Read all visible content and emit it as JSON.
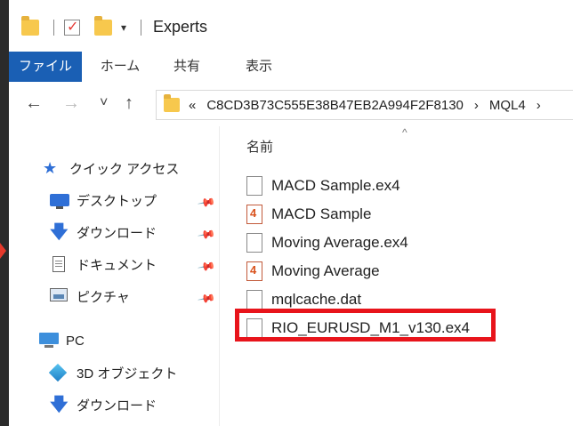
{
  "window": {
    "title": "Experts"
  },
  "ribbon": {
    "tabs": [
      "ファイル",
      "ホーム",
      "共有",
      "表示"
    ]
  },
  "nav": {
    "back": "←",
    "forward": "→",
    "recent": "˅",
    "up": "↑"
  },
  "address": {
    "overflow": "«",
    "parts": [
      "C8CD3B73C555E38B47EB2A994F2F8130",
      "MQL4"
    ],
    "separator": "›"
  },
  "navpane": {
    "quick_access": "クイック アクセス",
    "items": [
      "デスクトップ",
      "ダウンロード",
      "ドキュメント",
      "ピクチャ"
    ],
    "pc": "PC",
    "pc_items": [
      "3D オブジェクト",
      "ダウンロード"
    ]
  },
  "filelist": {
    "column_name": "名前",
    "sort_indicator": "^",
    "files": [
      {
        "name": "MACD Sample.ex4",
        "type": "ex4"
      },
      {
        "name": "MACD Sample",
        "type": "mq4"
      },
      {
        "name": "Moving Average.ex4",
        "type": "ex4"
      },
      {
        "name": "Moving Average",
        "type": "mq4"
      },
      {
        "name": "mqlcache.dat",
        "type": "dat"
      },
      {
        "name": "RIO_EURUSD_M1_v130.ex4",
        "type": "ex4"
      }
    ]
  },
  "colors": {
    "file_tab": "#1a5fb4",
    "highlight": "#e8141b",
    "folder": "#f7c84d"
  }
}
